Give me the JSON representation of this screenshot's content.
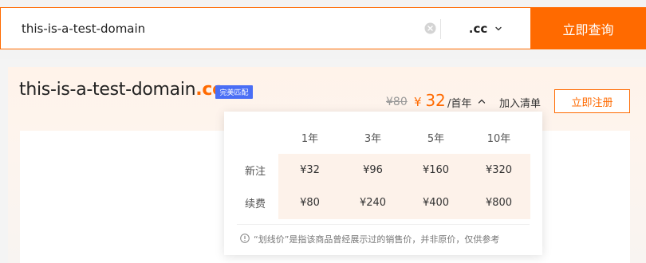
{
  "search": {
    "query": "this-is-a-test-domain",
    "suffix": ".cc",
    "button_label": "立即查询"
  },
  "result": {
    "domain_name": "this-is-a-test-domain",
    "domain_suffix": ".cc",
    "badge": "完美匹配",
    "original_price": "¥80",
    "currency": "¥",
    "current_price": "32",
    "price_unit": "/首年",
    "add_to_list": "加入清单",
    "register_label": "立即注册"
  },
  "price_table": {
    "headers": [
      "1年",
      "3年",
      "5年",
      "10年"
    ],
    "rows": [
      {
        "label": "新注",
        "values": [
          "¥32",
          "¥96",
          "¥160",
          "¥320"
        ]
      },
      {
        "label": "续费",
        "values": [
          "¥80",
          "¥240",
          "¥400",
          "¥800"
        ]
      }
    ],
    "note": "“划线价”是指该商品曾经展示过的销售价，并非原价，仅供参考"
  },
  "colors": {
    "accent": "#ff6a00",
    "badge": "#4a6ef5"
  },
  "icons": {
    "clear": "clear-icon",
    "dropdown": "chevron-down-icon",
    "toggle": "chevron-up-icon",
    "info": "info-icon"
  }
}
